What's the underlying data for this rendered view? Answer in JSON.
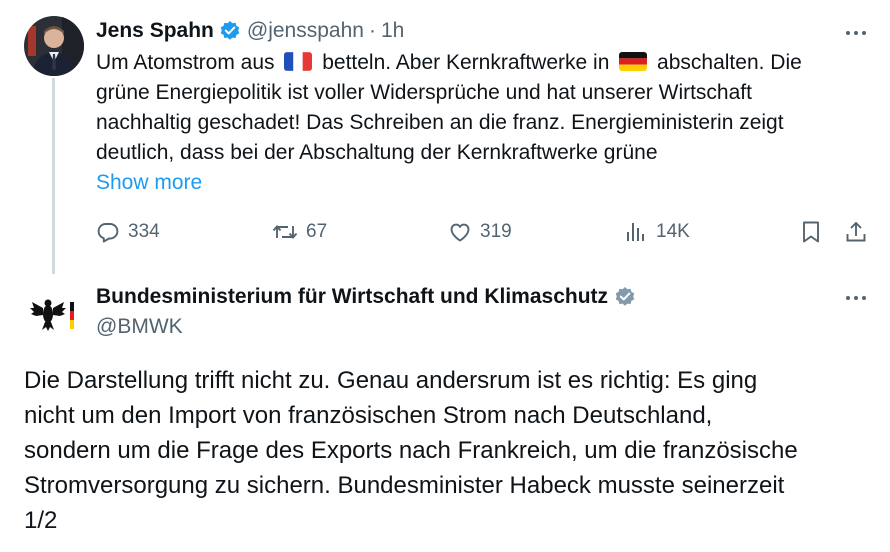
{
  "tweet1": {
    "name": "Jens Spahn",
    "handle": "@jensspahn",
    "separator": "·",
    "time": "1h",
    "lines": [
      [
        "Um Atomstrom aus ",
        " betteln. Aber Kernkraftwerke in ",
        " abschalten. Die"
      ],
      "grüne Energiepolitik ist voller Widersprüche und hat unserer Wirtschaft",
      "nachhaltig geschadet! Das Schreiben an die franz. Energieministerin zeigt",
      "deutlich, dass bei der Abschaltung der Kernkraftwerke grüne"
    ],
    "show_more": "Show more",
    "stats": {
      "replies": "334",
      "reposts": "67",
      "likes": "319",
      "views": "14K"
    },
    "icons": [
      "reply-icon",
      "repost-icon",
      "like-icon",
      "views-icon",
      "bookmark-icon",
      "share-icon"
    ],
    "flags": [
      "france-flag-emoji",
      "germany-flag-emoji"
    ]
  },
  "tweet2": {
    "name": "Bundesministerium für Wirtschaft und Klimaschutz",
    "handle": "@BMWK",
    "lines": [
      "Die Darstellung trifft nicht zu. Genau andersrum ist es richtig: Es ging",
      "nicht um den Import von französischen Strom nach Deutschland,",
      "sondern um die Frage des Exports nach Frankreich, um die französische",
      "Stromversorgung zu sichern. Bundesminister Habeck musste seinerzeit",
      "1/2"
    ]
  },
  "colors": {
    "text": "#0f1419",
    "secondary": "#536471",
    "link": "#1d9bf0",
    "verified_blue": "#1d9bf0",
    "verified_grey": "#829aab",
    "thread_line": "#cfd9de"
  }
}
